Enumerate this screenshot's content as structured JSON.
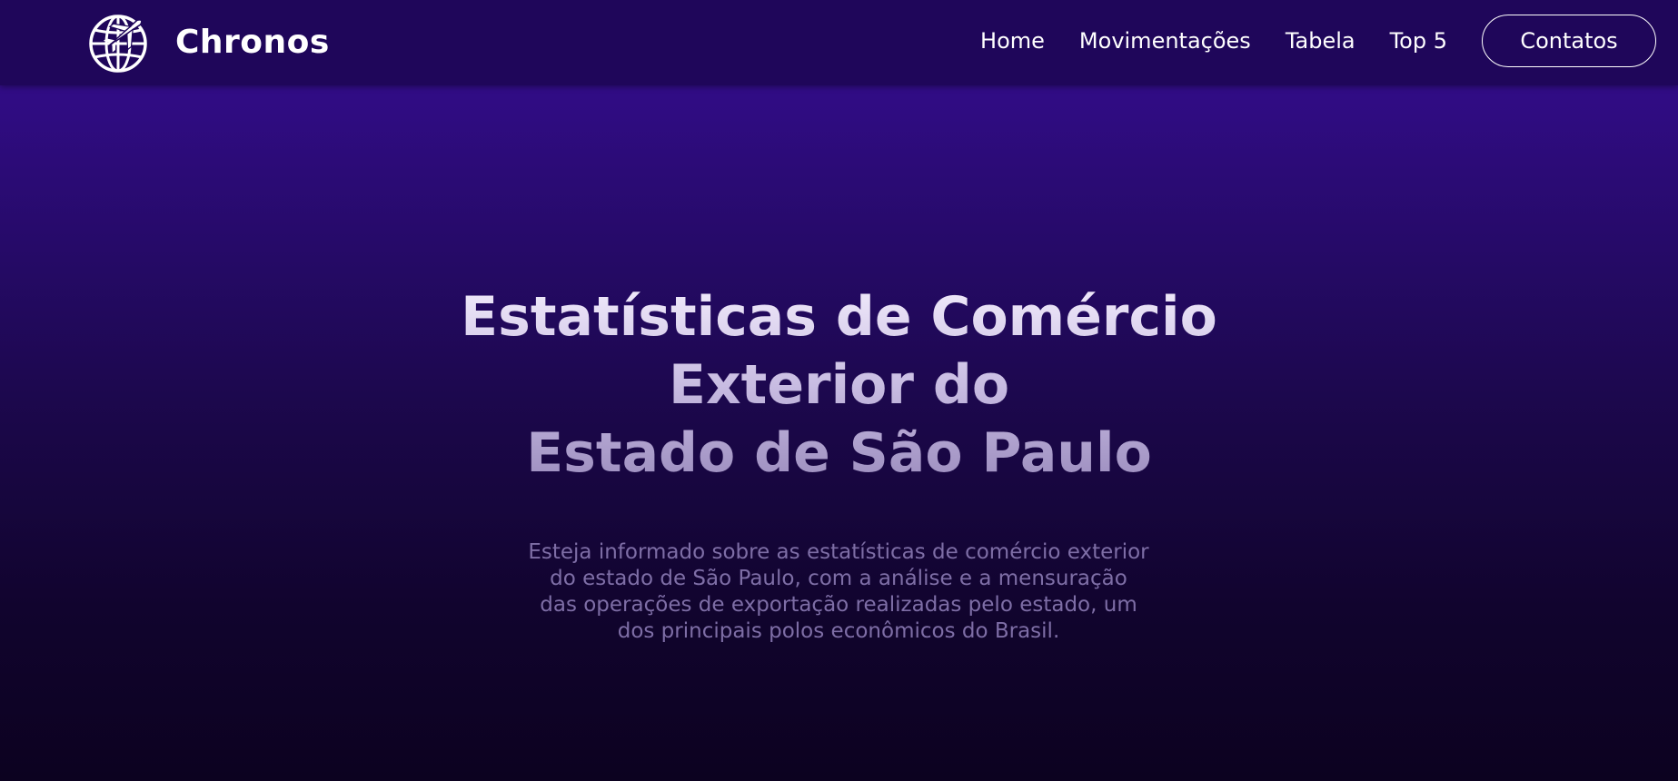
{
  "navbar": {
    "brand": {
      "name": "Chronos",
      "logo_icon": "globe-airplane-icon"
    },
    "links": [
      {
        "label": "Home"
      },
      {
        "label": "Movimentações"
      },
      {
        "label": "Tabela"
      },
      {
        "label": "Top 5"
      }
    ],
    "contact_label": "Contatos"
  },
  "hero": {
    "title_lines": [
      "Estatísticas de Comércio",
      "Exterior do",
      "Estado de São Paulo"
    ],
    "description_lines": [
      "Esteja informado sobre as estatísticas de comércio exterior",
      "do estado de São Paulo, com a análise e a mensuração",
      "das operações de exportação realizadas pelo estado, um",
      "dos principais polos econômicos do Brasil."
    ]
  },
  "colors": {
    "navbar_bg": "#1f065a",
    "hero_gradient_top": "#310c86",
    "hero_gradient_bottom": "#0c0220",
    "title_text": "#f1ebfb",
    "description_text": "#7e6ea6"
  }
}
